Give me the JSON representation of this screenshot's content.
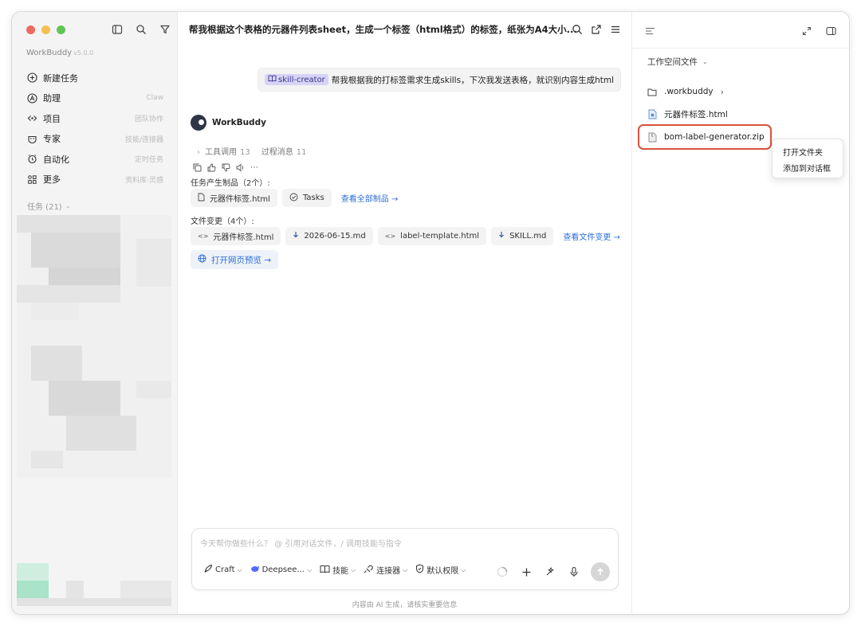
{
  "window": {
    "traffic_colors": [
      "#ed6a5e",
      "#f5bf4f",
      "#61c554"
    ]
  },
  "sidebar": {
    "app_name": "WorkBuddy",
    "version": "v5.0.0",
    "top_icons": [
      "sidebar-toggle-icon",
      "search-icon",
      "filter-icon"
    ],
    "items": [
      {
        "label": "新建任务",
        "hint": "",
        "icon": "plus-circle-icon"
      },
      {
        "label": "助理",
        "hint": "Claw",
        "icon": "assistant-icon"
      },
      {
        "label": "项目",
        "hint": "团队协作",
        "icon": "project-icon"
      },
      {
        "label": "专家",
        "hint": "技能/连接器",
        "icon": "expert-icon"
      },
      {
        "label": "自动化",
        "hint": "定时任务",
        "icon": "alarm-icon"
      },
      {
        "label": "更多",
        "hint": "资料库·灵感",
        "icon": "grid-icon"
      }
    ],
    "tasks_header": "任务 (21)"
  },
  "main": {
    "title": "帮我根据这个表格的元器件列表sheet，生成一个标签（html格式）的标签，纸张为A4大小...",
    "user_message": {
      "skill_chip": "skill-creator",
      "text": "帮我根据我的打标签需求生成skills，下次我发送表格，就识别内容生成html"
    },
    "bot_name": "WorkBuddy",
    "meta": {
      "tools_label": "工具调用",
      "tools_count": "13",
      "process_label": "过程消息",
      "process_count": "11"
    },
    "artifacts": {
      "label": "任务产生制品（2个）:",
      "items": [
        "元器件标签.html",
        "Tasks"
      ],
      "link": "查看全部制品 →"
    },
    "changes": {
      "label": "文件变更（4个）:",
      "items": [
        "元器件标签.html",
        "2026-06-15.md",
        "label-template.html",
        "SKILL.md"
      ],
      "link": "查看文件变更 →"
    },
    "preview_button": "打开网页预览 →",
    "composer": {
      "placeholder": "今天帮你做些什么？ @ 引用对话文件，/ 调用技能与指令",
      "mode": "Craft",
      "model": "Deepsee...",
      "skills": "技能",
      "connectors": "连接器",
      "permission": "默认权限"
    },
    "footer_note": "内容由 AI 生成，请核实重要信息"
  },
  "right_panel": {
    "workspace_title": "工作空间文件",
    "files": [
      ".workbuddy",
      "元器件标签.html",
      "bom-label-generator.zip"
    ],
    "context_menu": [
      "打开文件夹",
      "添加到对话框"
    ],
    "highlight_color": "#d9533b"
  }
}
